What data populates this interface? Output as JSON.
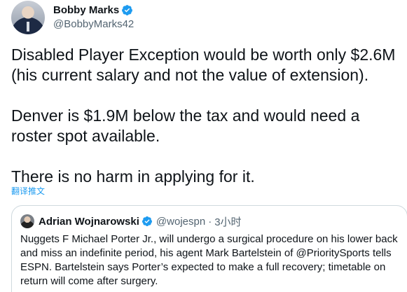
{
  "author": {
    "display_name": "Bobby Marks",
    "handle": "@BobbyMarks42"
  },
  "tweet": {
    "paragraphs": [
      "Disabled Player Exception would be worth only $2.6M (his current salary and not the value of extension).",
      "Denver is $1.9M below the tax and would need a roster spot available.",
      "There is no harm in applying for it."
    ],
    "translate_label": "翻译推文"
  },
  "quoted_tweet": {
    "display_name": "Adrian Wojnarowski",
    "handle": "@wojespn",
    "separator": "·",
    "time": "3小时",
    "text": "Nuggets F Michael Porter Jr., will undergo a surgical procedure on his lower back and miss an indefinite period, his agent Mark Bartelstein of @PrioritySports tells ESPN. Bartelstein says Porter’s expected to make a full recovery; timetable on return will come after surgery."
  },
  "colors": {
    "accent": "#1d9bf0",
    "verified": "#1d9bf0",
    "secondary_text": "#536471",
    "border": "#cfd9de"
  },
  "icons": {
    "verified": "verified-badge-icon"
  }
}
